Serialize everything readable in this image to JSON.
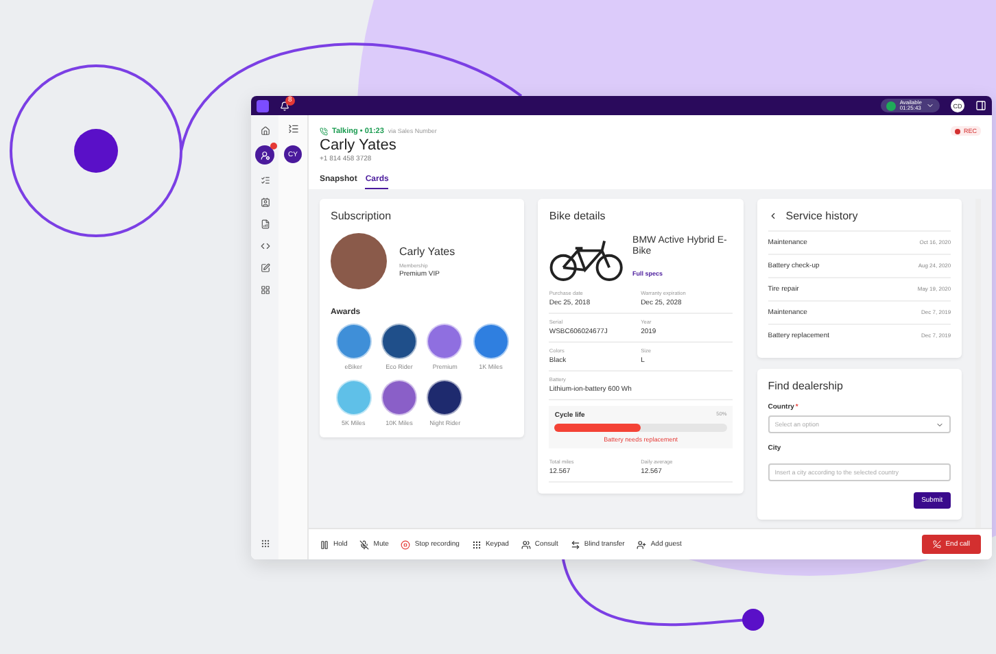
{
  "topbar": {
    "notification_count": "8",
    "status_label": "Available",
    "status_time": "01:25:43",
    "user_initials": "CD"
  },
  "nav": [
    {
      "kind": "home",
      "selected": false,
      "badge": false
    },
    {
      "kind": "agent",
      "selected": true,
      "badge": true
    },
    {
      "kind": "list",
      "selected": false,
      "badge": false
    },
    {
      "kind": "contact",
      "selected": false,
      "badge": false
    },
    {
      "kind": "report",
      "selected": false,
      "badge": false
    },
    {
      "kind": "code",
      "selected": false,
      "badge": false
    },
    {
      "kind": "edit",
      "selected": false,
      "badge": false
    },
    {
      "kind": "apps",
      "selected": false,
      "badge": false
    }
  ],
  "contacts": [
    {
      "initials": "CY",
      "selected": true
    }
  ],
  "call": {
    "status": "Talking • 01:23",
    "via": "via Sales Number",
    "name": "Carly Yates",
    "phone": "+1 814 458 3728",
    "rec": "REC"
  },
  "tabs": [
    {
      "label": "Snapshot",
      "selected": false
    },
    {
      "label": "Cards",
      "selected": true
    }
  ],
  "subscription": {
    "title": "Subscription",
    "name": "Carly Yates",
    "membership_label": "Membership",
    "membership": "Premium VIP",
    "awards_title": "Awards",
    "awards": [
      {
        "label": "eBiker",
        "color": "#3f8fd8"
      },
      {
        "label": "Eco Rider",
        "color": "#1f4f8a"
      },
      {
        "label": "Premium",
        "color": "#8f6fe0"
      },
      {
        "label": "1K Miles",
        "color": "#2f7fe0"
      },
      {
        "label": "5K Miles",
        "color": "#5fc0e8"
      },
      {
        "label": "10K Miles",
        "color": "#8a5fc8"
      },
      {
        "label": "Night Rider",
        "color": "#1e2a6e"
      }
    ]
  },
  "bike": {
    "title": "Bike details",
    "name": "BMW Active Hybrid E-Bike",
    "link": "Full specs",
    "rows": [
      [
        {
          "label": "Purchase date",
          "value": "Dec 25, 2018"
        },
        {
          "label": "Warranty expiration",
          "value": "Dec 25, 2028"
        }
      ],
      [
        {
          "label": "Serial",
          "value": "WSBC606024677J"
        },
        {
          "label": "Year",
          "value": "2019"
        }
      ],
      [
        {
          "label": "Colors",
          "value": "Black"
        },
        {
          "label": "Size",
          "value": "L"
        }
      ],
      [
        {
          "label": "Battery",
          "value": "Lithium-ion-battery 600 Wh"
        }
      ]
    ],
    "cycle": {
      "label": "Cycle life",
      "reading": "50%",
      "level": 0.5,
      "warning": "Battery needs replacement"
    },
    "stats": [
      {
        "label": "Total miles",
        "value": "12.567"
      },
      {
        "label": "Daily average",
        "value": "12.567"
      }
    ]
  },
  "service": {
    "title": "Service history",
    "items": [
      {
        "name": "Maintenance",
        "date": "Oct 16, 2020"
      },
      {
        "name": "Battery check-up",
        "date": "Aug 24, 2020"
      },
      {
        "name": "Tire repair",
        "date": "May 19, 2020"
      },
      {
        "name": "Maintenance",
        "date": "Dec 7, 2019"
      },
      {
        "name": "Battery replacement",
        "date": "Dec 7, 2019"
      }
    ]
  },
  "dealership": {
    "title": "Find dealership",
    "country_label": "Country",
    "required_mark": "*",
    "country_placeholder": "Select an option",
    "city_label": "City",
    "city_placeholder": "Insert a city according to the selected country",
    "submit": "Submit"
  },
  "call_bar": {
    "actions": [
      {
        "kind": "hold",
        "label": "Hold"
      },
      {
        "kind": "mute",
        "label": "Mute"
      },
      {
        "kind": "record",
        "label": "Stop recording"
      },
      {
        "kind": "keypad",
        "label": "Keypad"
      },
      {
        "kind": "consult",
        "label": "Consult"
      },
      {
        "kind": "transfer",
        "label": "Blind transfer"
      },
      {
        "kind": "guest",
        "label": "Add guest"
      }
    ],
    "end": "End call"
  }
}
